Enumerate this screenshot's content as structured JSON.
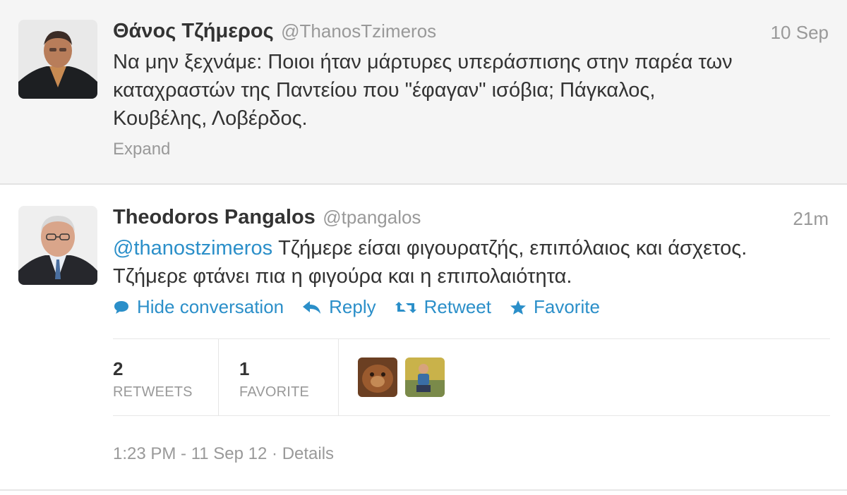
{
  "parent_tweet": {
    "fullname": "Θάνος Τζήμερος",
    "username": "@ThanosTzimeros",
    "time": "10 Sep",
    "text_lines": [
      "Να μην ξεχνάμε: Ποιοι ήταν μάρτυρες υπεράσπισης στην παρέα των",
      "καταχραστών της Παντείου που \"έφαγαν\" ισόβια; Πάγκαλος,",
      "Κουβέλης, Λοβέρδος."
    ],
    "expand_label": "Expand"
  },
  "main_tweet": {
    "fullname": "Theodoros Pangalos",
    "username": "@tpangalos",
    "time": "21m",
    "mention": "@thanostzimeros",
    "text_line1_rest": " Τζήμερε είσαι φιγουρατζής, επιπόλαιος και άσχετος.",
    "text_line2": "Τζήμερε φτάνει πια η φιγούρα και η επιπολαιότητα."
  },
  "actions": {
    "hide_conversation": {
      "label": "Hide conversation",
      "icon": "speech-bubble-icon"
    },
    "reply": {
      "label": "Reply",
      "icon": "reply-arrow-icon"
    },
    "retweet": {
      "label": "Retweet",
      "icon": "retweet-icon"
    },
    "favorite": {
      "label": "Favorite",
      "icon": "star-icon"
    }
  },
  "stats": {
    "retweets_count": "2",
    "retweets_label": "RETWEETS",
    "favorites_count": "1",
    "favorites_label": "FAVORITE"
  },
  "footer": {
    "timestamp": "1:23 PM - 11 Sep 12",
    "separator": " · ",
    "details_label": "Details"
  },
  "colors": {
    "link": "#2b8fc9",
    "muted": "#999999",
    "text": "#333333",
    "parent_bg": "#f5f5f5"
  }
}
